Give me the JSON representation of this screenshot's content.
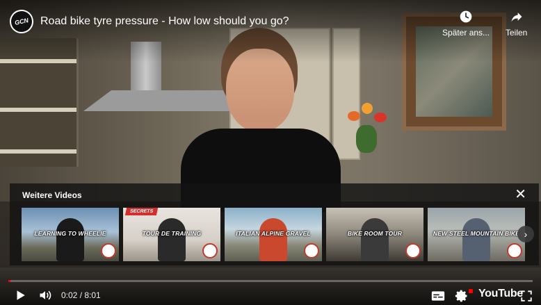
{
  "header": {
    "channel_logo_text": "GCN",
    "title": "Road bike tyre pressure - How low should you go?",
    "watch_later_label": "Später ans...",
    "share_label": "Teilen"
  },
  "more_videos": {
    "title": "Weitere Videos",
    "items": [
      {
        "label": "LEARNING TO WHEELIE",
        "bg_color": "#6c8fb4"
      },
      {
        "label": "TOUR DE TRAINING",
        "bg_color": "#e9e4df",
        "badge": "SECRETS"
      },
      {
        "label": "ITALIAN ALPINE GRAVEL",
        "bg_color": "#8ab0c8"
      },
      {
        "label": "BIKE ROOM TOUR",
        "bg_color": "#c7c0b5"
      },
      {
        "label": "NEW STEEL MOUNTAIN BIKE",
        "bg_color": "#9aa4a9"
      }
    ]
  },
  "controls": {
    "current_time": "0:02",
    "duration": "8:01",
    "time_separator": " / ",
    "progress": 0.004,
    "brand": "YouTube"
  },
  "colors": {
    "accent": "#ff0000",
    "panel_bg": "#141414"
  }
}
